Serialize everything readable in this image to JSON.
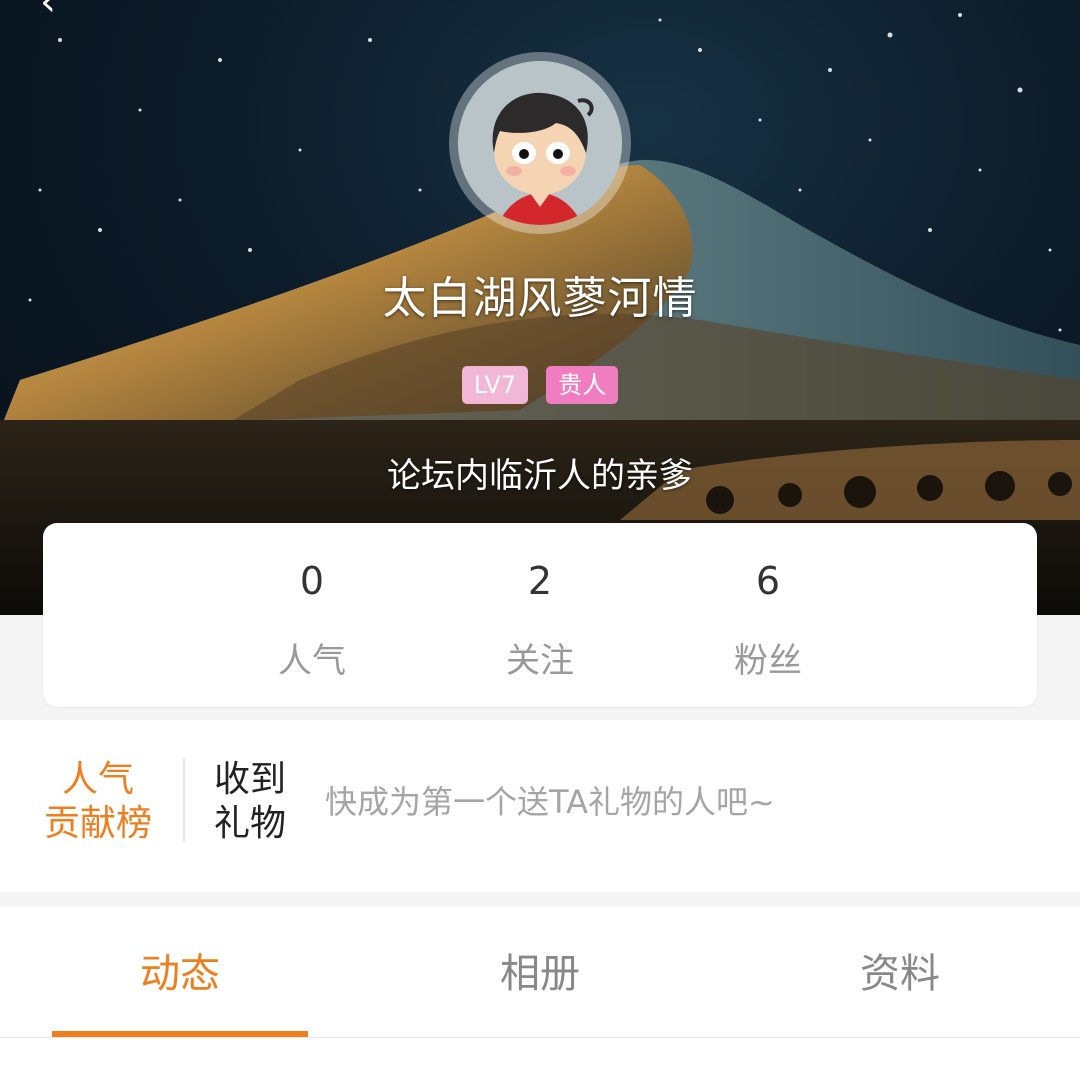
{
  "profile": {
    "username": "太白湖风蓼河情",
    "level_badge": "LV7",
    "vip_badge": "贵人",
    "signature": "论坛内临沂人的亲爹",
    "avatar_icon": "cartoon-boy-avatar",
    "back_icon": "chevron-left-icon"
  },
  "stats": [
    {
      "value": "0",
      "label": "人气"
    },
    {
      "value": "2",
      "label": "关注"
    },
    {
      "value": "6",
      "label": "粉丝"
    }
  ],
  "gifts": {
    "rank_label": "人气贡献榜",
    "rank_line1": "人气",
    "rank_line2": "贡献榜",
    "received_line1": "收到",
    "received_line2": "礼物",
    "hint": "快成为第一个送TA礼物的人吧~"
  },
  "tabs": [
    {
      "label": "动态",
      "active": true
    },
    {
      "label": "相册",
      "active": false
    },
    {
      "label": "资料",
      "active": false
    }
  ],
  "colors": {
    "accent": "#ee7f1f",
    "level_badge_bg": "#f2b6d6",
    "vip_badge_bg": "#f07dc0"
  }
}
